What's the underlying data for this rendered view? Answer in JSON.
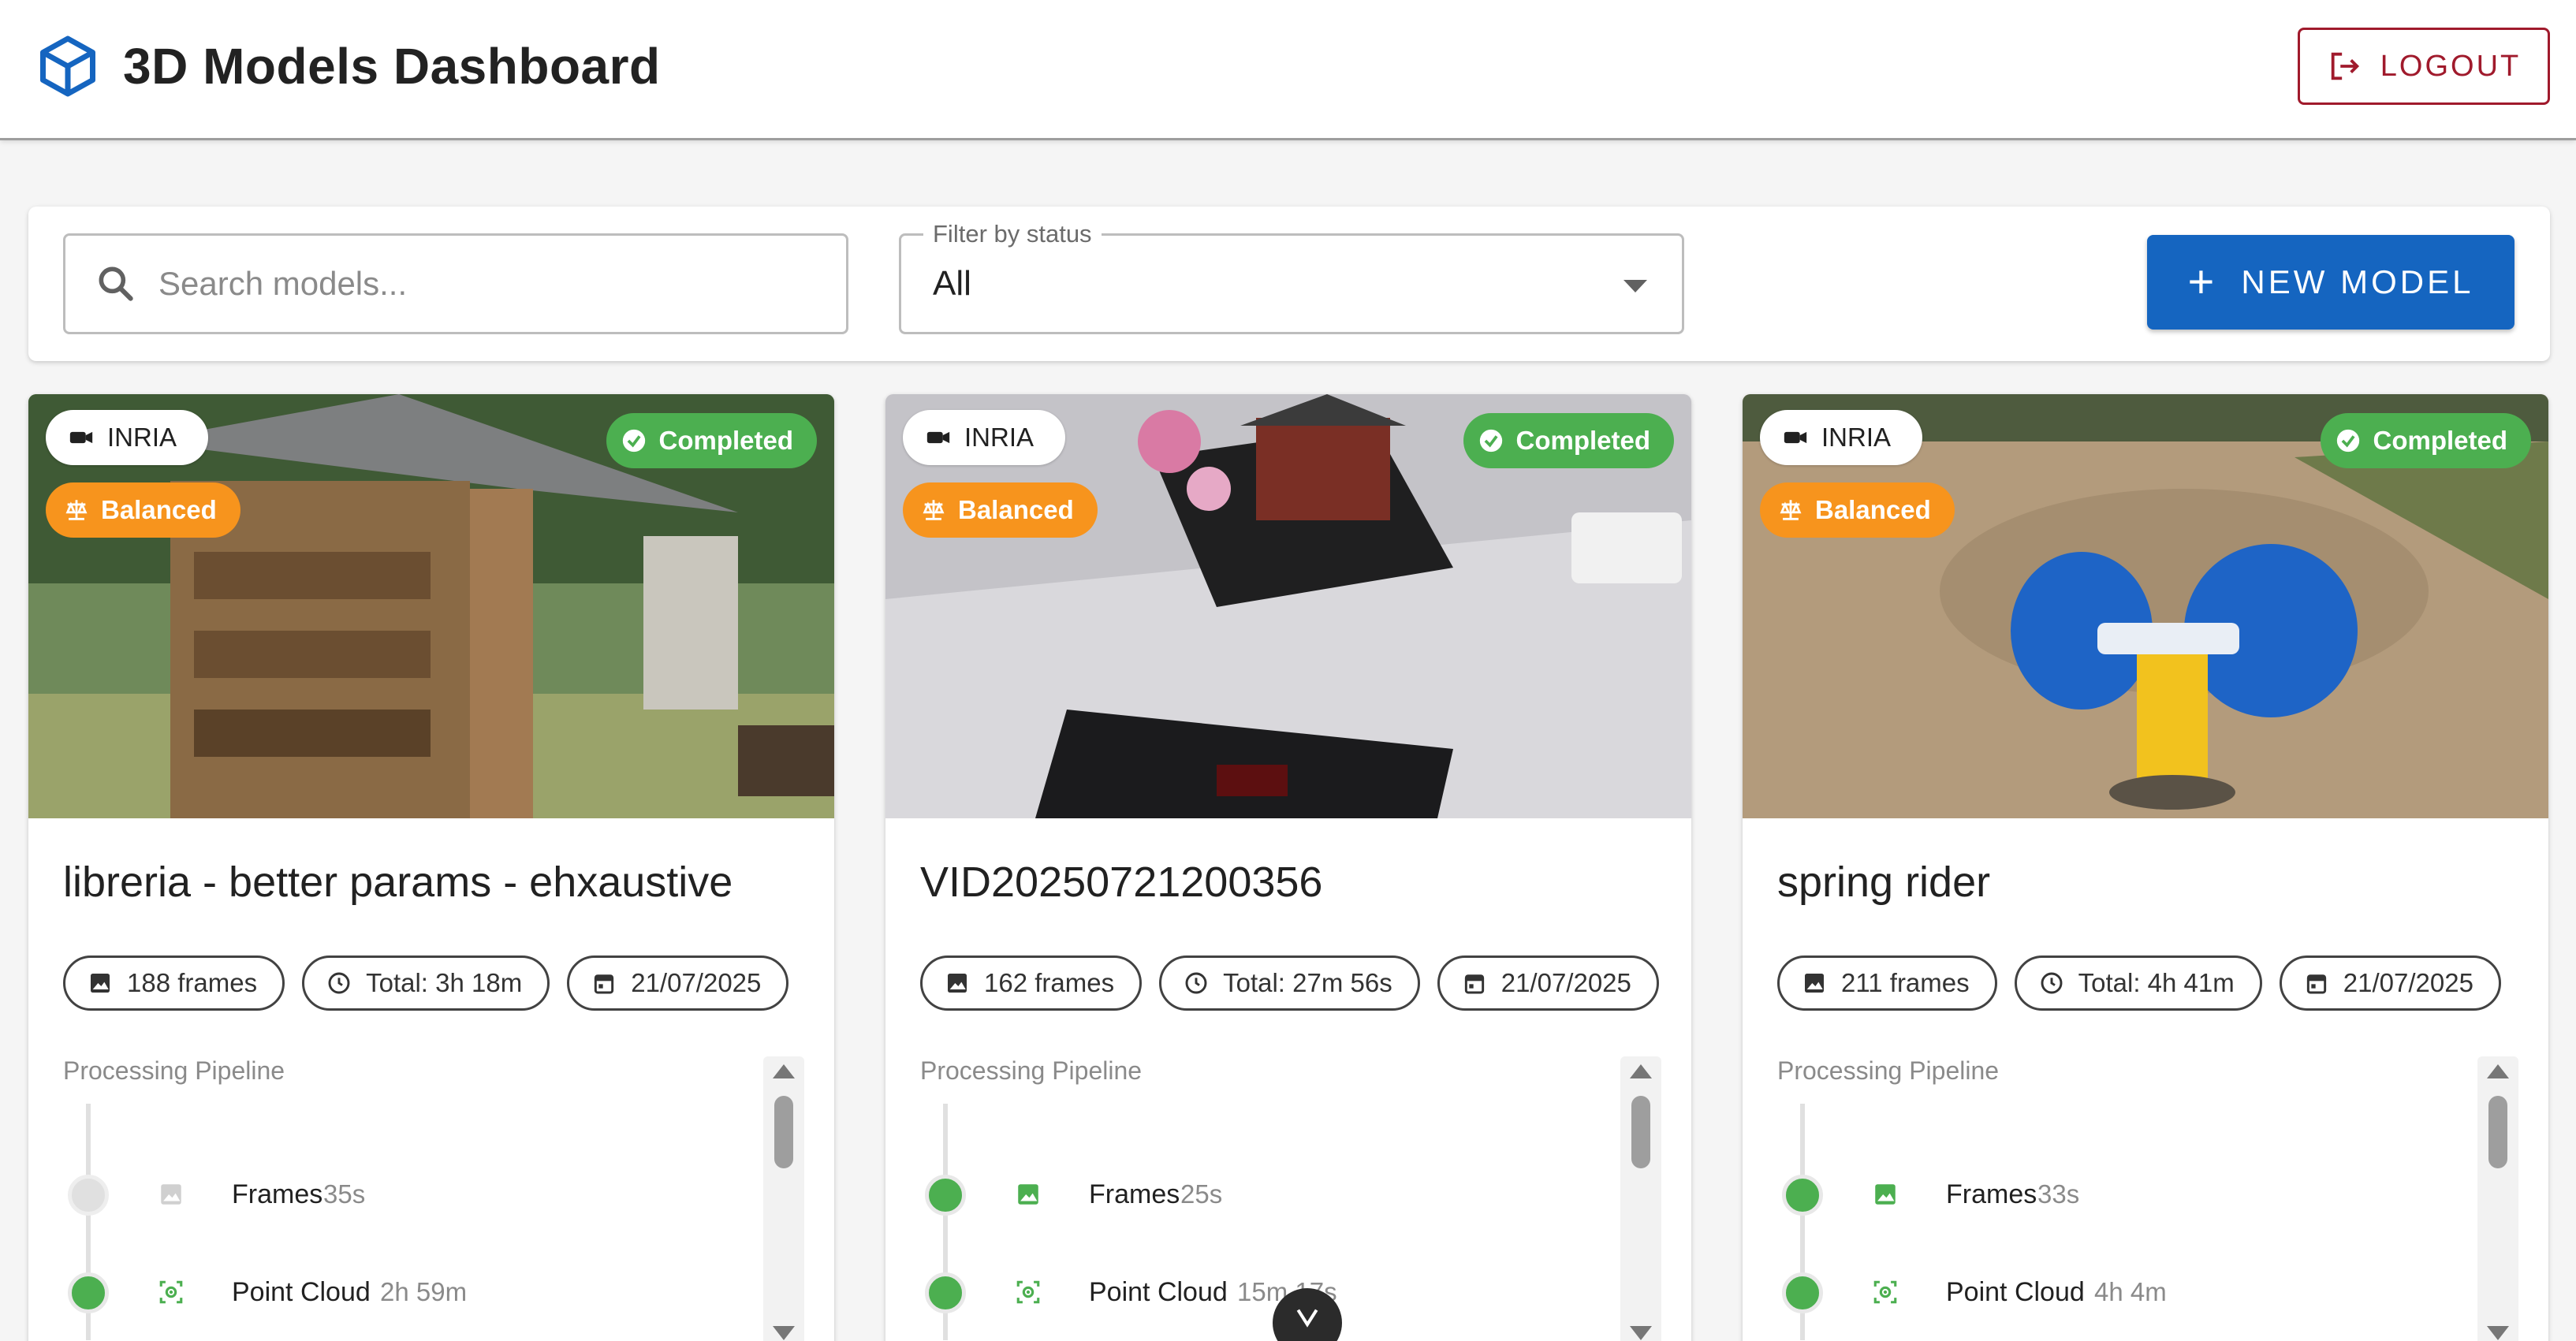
{
  "header": {
    "title": "3D Models Dashboard",
    "logout_label": "LOGOUT",
    "logo_icon": "cube-icon"
  },
  "toolbar": {
    "search_placeholder": "Search models...",
    "search_value": "",
    "filter_label": "Filter by status",
    "filter_value": "All",
    "new_model_label": "NEW MODEL"
  },
  "colors": {
    "primary": "#1565c0",
    "logout": "#a01a2c",
    "completed": "#4caf50",
    "balanced": "#f7941d"
  },
  "cards": [
    {
      "source": "INRIA",
      "quality": "Balanced",
      "status": "Completed",
      "title": "libreria - better params - ehxaustive",
      "frames": "188 frames",
      "total": "Total: 3h 18m",
      "date": "21/07/2025",
      "pipeline_label": "Processing Pipeline",
      "steps": [
        {
          "name": "Frames",
          "time": "35s",
          "state": "pending"
        },
        {
          "name": "Point Cloud",
          "time": "2h 59m",
          "state": "done"
        }
      ]
    },
    {
      "source": "INRIA",
      "quality": "Balanced",
      "status": "Completed",
      "title": "VID20250721200356",
      "frames": "162 frames",
      "total": "Total: 27m 56s",
      "date": "21/07/2025",
      "pipeline_label": "Processing Pipeline",
      "steps": [
        {
          "name": "Frames",
          "time": "25s",
          "state": "done"
        },
        {
          "name": "Point Cloud",
          "time": "15m 17s",
          "state": "done"
        }
      ]
    },
    {
      "source": "INRIA",
      "quality": "Balanced",
      "status": "Completed",
      "title": "spring rider",
      "frames": "211 frames",
      "total": "Total: 4h 41m",
      "date": "21/07/2025",
      "pipeline_label": "Processing Pipeline",
      "steps": [
        {
          "name": "Frames",
          "time": "33s",
          "state": "done"
        },
        {
          "name": "Point Cloud",
          "time": "4h 4m",
          "state": "done"
        }
      ]
    }
  ]
}
